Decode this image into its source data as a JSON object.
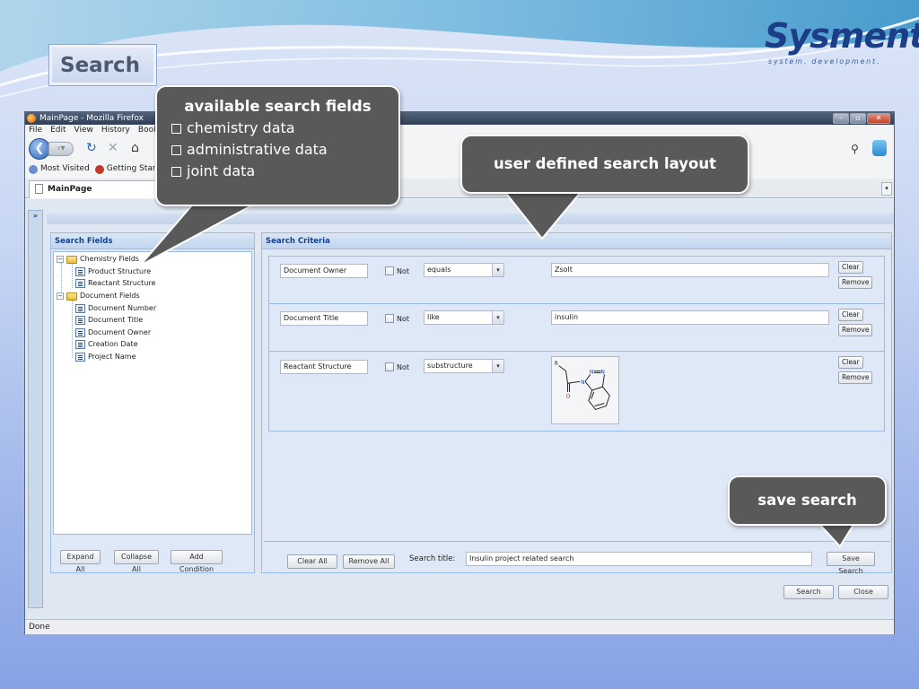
{
  "slide": {
    "title": "Search",
    "logo": {
      "name": "Sysment",
      "tagline": "system. development."
    }
  },
  "browser": {
    "window_title": "MainPage - Mozilla Firefox",
    "menu": [
      "File",
      "Edit",
      "View",
      "History",
      "Bookm"
    ],
    "bookmarks": [
      "Most Visited",
      "Getting Started"
    ],
    "tab_title": "MainPage",
    "status": "Done"
  },
  "search_fields": {
    "title": "Search Fields",
    "groups": [
      {
        "label": "Chemistry Fields",
        "items": [
          "Product Structure",
          "Reactant Structure"
        ]
      },
      {
        "label": "Document Fields",
        "items": [
          "Document Number",
          "Document Title",
          "Document Owner",
          "Creation Date",
          "Project Name"
        ]
      }
    ],
    "buttons": {
      "expand": "Expand All",
      "collapse": "Collapse All",
      "add": "Add Condition"
    }
  },
  "criteria": {
    "title": "Search Criteria",
    "not_label": "Not",
    "clear_label": "Clear",
    "remove_label": "Remove",
    "rows": [
      {
        "field": "Document Owner",
        "operator": "equals",
        "value": "Zsolt"
      },
      {
        "field": "Document Title",
        "operator": "like",
        "value": "insulin"
      },
      {
        "field": "Reactant Structure",
        "operator": "substructure",
        "value": ""
      }
    ],
    "structure_atoms": {
      "r": "R",
      "n1": "N",
      "n2": "N",
      "n3": "N",
      "o": "O"
    }
  },
  "bottom": {
    "clear_all": "Clear All",
    "remove_all": "Remove All",
    "search_title_label": "Search title:",
    "search_title_value": "Insulin project related search",
    "save_search": "Save Search",
    "search": "Search",
    "close": "Close"
  },
  "callouts": {
    "fields": {
      "heading": "available search fields",
      "bullets": [
        "chemistry data",
        "administrative data",
        "joint data"
      ]
    },
    "layout": "user defined search layout",
    "save": "save search"
  },
  "colors": {
    "panel_header_text": "#15428b",
    "panel_border": "#99bbe8",
    "callout_bg": "#595959",
    "logo_blue": "#1c3d87"
  }
}
